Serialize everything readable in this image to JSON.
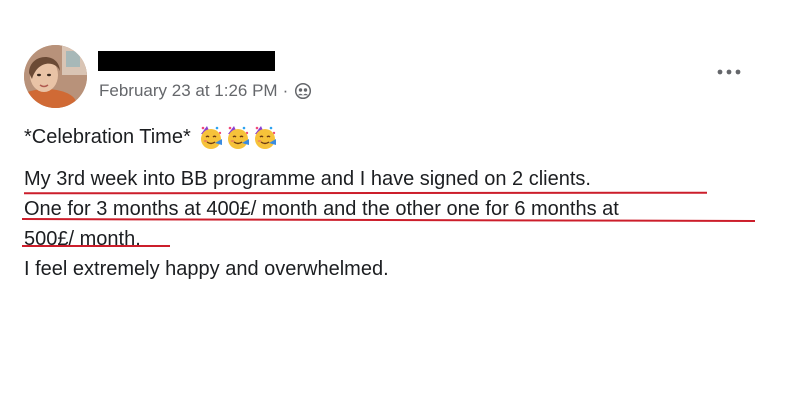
{
  "post": {
    "timestamp": "February 23 at 1:26 PM",
    "separator": "·",
    "privacy_icon": "friends-globe-icon",
    "more_icon": "more-horizontal-icon",
    "headline_text": "*Celebration Time*",
    "headline_emoji_icon": "partying-face-emoji-icon",
    "headline_emoji_count": 3,
    "body_lines": [
      "My 3rd week into BB programme and I have signed on 2 clients.",
      "One for 3 months at 400£/ month and the other one for 6 months at",
      "500£/ month.",
      "I feel extremely happy and overwhelmed."
    ]
  },
  "colors": {
    "meta_text": "#65676b",
    "text": "#1c1e21",
    "underline": "#cc1e2b",
    "redaction": "#000000"
  }
}
